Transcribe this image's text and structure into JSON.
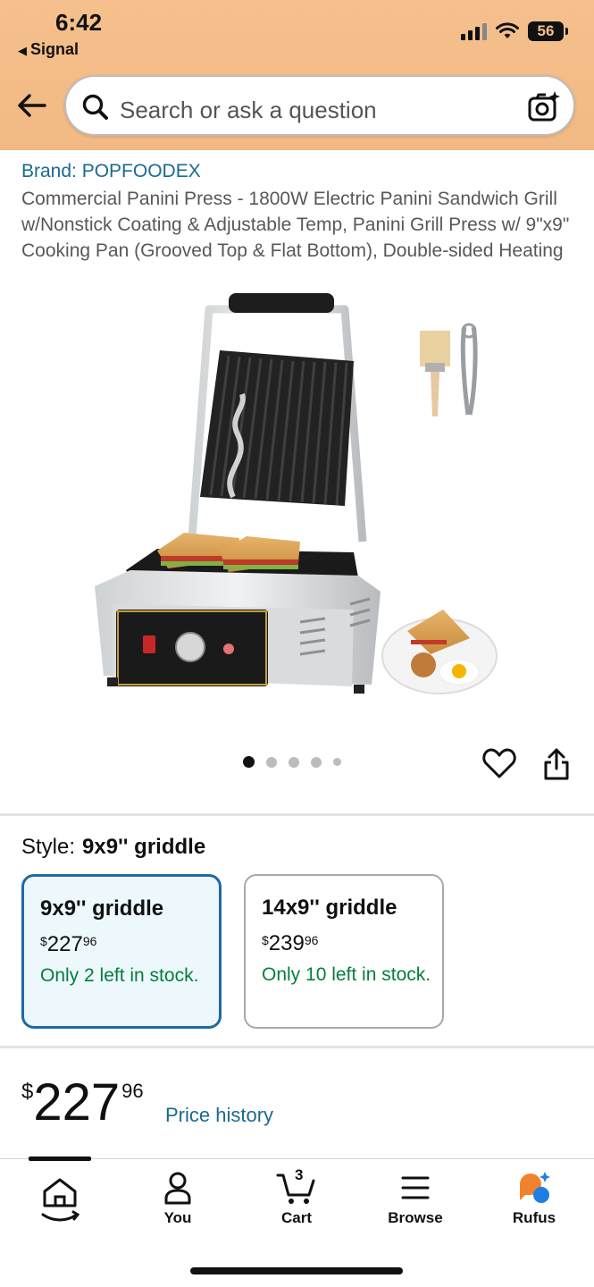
{
  "status_bar": {
    "time": "6:42",
    "back_app": "Signal",
    "battery": "56"
  },
  "search": {
    "placeholder": "Search or ask a question"
  },
  "product": {
    "brand": "Brand: POPFOODEX",
    "title": "Commercial Panini Press - 1800W Electric Panini Sandwich Grill w/Nonstick Coating & Adjustable Temp, Panini Grill Press w/ 9\"x9\" Cooking Pan (Grooved Top & Flat Bottom), Double-sided Heating",
    "image_count": 5,
    "image_selected": 1
  },
  "style": {
    "label": "Style:",
    "selected": "9x9'' griddle",
    "options": [
      {
        "name": "9x9'' griddle",
        "currency": "$",
        "whole": "227",
        "fraction": "96",
        "stock": "Only 2 left in stock.",
        "selected": true
      },
      {
        "name": "14x9'' griddle",
        "currency": "$",
        "whole": "239",
        "fraction": "96",
        "stock": "Only 10 left in stock.",
        "selected": false
      }
    ]
  },
  "price": {
    "currency": "$",
    "whole": "227",
    "fraction": "96",
    "history_link": "Price history"
  },
  "nav": {
    "items": [
      {
        "label": "",
        "icon": "home-icon"
      },
      {
        "label": "You",
        "icon": "user-icon"
      },
      {
        "label": "Cart",
        "icon": "cart-icon",
        "badge": "3"
      },
      {
        "label": "Browse",
        "icon": "menu-icon"
      },
      {
        "label": "Rufus",
        "icon": "rufus-icon"
      }
    ]
  },
  "colors": {
    "header": "#f2b983",
    "link": "#1a6a8f",
    "stock": "#067d3d",
    "selected_border": "#1e6aa5",
    "rufus_orange": "#f2832e",
    "rufus_blue": "#1e7fe0"
  }
}
